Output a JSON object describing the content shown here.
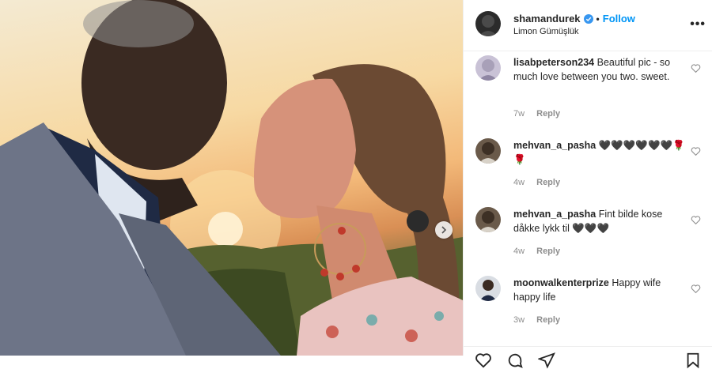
{
  "post": {
    "username": "shamandurek",
    "follow_label": "Follow",
    "separator": "•",
    "location": "Limon Gümüşlük",
    "more_label": "•••",
    "colors": {
      "accent": "#0095f6",
      "muted": "#8e8e8e",
      "text": "#262626",
      "verified": "#3897f0"
    }
  },
  "comments": [
    {
      "user": "lisabpeterson234",
      "text": "Beautiful pic - so much love between you two. sweet.",
      "age": "7w",
      "reply": "Reply"
    },
    {
      "user": "mehvan_a_pasha",
      "text": "🖤🖤🖤🖤🖤🖤🌹 🌹",
      "age": "4w",
      "reply": "Reply"
    },
    {
      "user": "mehvan_a_pasha",
      "text": "Fint bilde kose dåkke lykk til 🖤🖤🖤",
      "age": "4w",
      "reply": "Reply"
    },
    {
      "user": "moonwalkenterprize",
      "text": "Happy wife happy life",
      "age": "3w",
      "reply": "Reply"
    }
  ],
  "icons": [
    "verified-icon",
    "more-options-icon",
    "heart-icon",
    "next-arrow-icon",
    "like-icon",
    "comment-icon",
    "share-icon",
    "save-icon"
  ]
}
